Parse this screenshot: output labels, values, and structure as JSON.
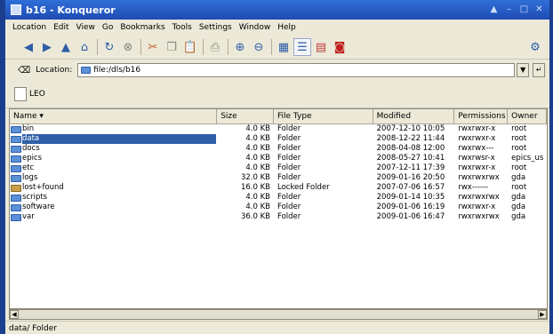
{
  "window": {
    "title": "b16 - Konqueror"
  },
  "menubar": [
    "Location",
    "Edit",
    "View",
    "Go",
    "Bookmarks",
    "Tools",
    "Settings",
    "Window",
    "Help"
  ],
  "toolbar": {
    "buttons": [
      "back-icon",
      "forward-icon",
      "up-icon",
      "home-icon",
      "reload-icon",
      "stop-icon",
      "cut-icon",
      "copy-icon",
      "paste-icon",
      "print-icon",
      "zoom-in-icon",
      "zoom-out-icon",
      "icon-view-icon",
      "detailed-view-icon",
      "tree-view-icon",
      "close-view-icon"
    ]
  },
  "location": {
    "label": "Location:",
    "value": "file:/dls/b16"
  },
  "bookmarks": {
    "item_label": "LEO"
  },
  "list": {
    "columns": [
      "Name",
      "Size",
      "File Type",
      "Modified",
      "Permissions",
      "Owner"
    ],
    "rows": [
      {
        "name": "bin",
        "size": "4.0 KB",
        "type": "Folder",
        "modified": "2007-12-10 10:05",
        "perm": "rwxrwxr-x",
        "owner": "root"
      },
      {
        "name": "data",
        "size": "4.0 KB",
        "type": "Folder",
        "modified": "2008-12-22 11:44",
        "perm": "rwxrwxr-x",
        "owner": "root"
      },
      {
        "name": "docs",
        "size": "4.0 KB",
        "type": "Folder",
        "modified": "2008-04-08 12:00",
        "perm": "rwxrwx---",
        "owner": "root"
      },
      {
        "name": "epics",
        "size": "4.0 KB",
        "type": "Folder",
        "modified": "2008-05-27 10:41",
        "perm": "rwxrwsr-x",
        "owner": "epics_us"
      },
      {
        "name": "etc",
        "size": "4.0 KB",
        "type": "Folder",
        "modified": "2007-12-11 17:39",
        "perm": "rwxrwxr-x",
        "owner": "root"
      },
      {
        "name": "logs",
        "size": "32.0 KB",
        "type": "Folder",
        "modified": "2009-01-16 20:50",
        "perm": "rwxrwxrwx",
        "owner": "gda"
      },
      {
        "name": "lost+found",
        "size": "16.0 KB",
        "type": "Locked Folder",
        "modified": "2007-07-06 16:57",
        "perm": "rwx------",
        "owner": "root"
      },
      {
        "name": "scripts",
        "size": "4.0 KB",
        "type": "Folder",
        "modified": "2009-01-14 10:35",
        "perm": "rwxrwxrwx",
        "owner": "gda"
      },
      {
        "name": "software",
        "size": "4.0 KB",
        "type": "Folder",
        "modified": "2009-01-06 16:19",
        "perm": "rwxrwxr-x",
        "owner": "gda"
      },
      {
        "name": "var",
        "size": "36.0 KB",
        "type": "Folder",
        "modified": "2009-01-06 16:47",
        "perm": "rwxrwxrwx",
        "owner": "gda"
      }
    ],
    "selected_row": "data"
  },
  "status": {
    "text": "data/  Folder"
  },
  "colors": {
    "titlebar": "#1e4cb3",
    "selection": "#2f5ea8",
    "folder": "#5b8fd6"
  }
}
